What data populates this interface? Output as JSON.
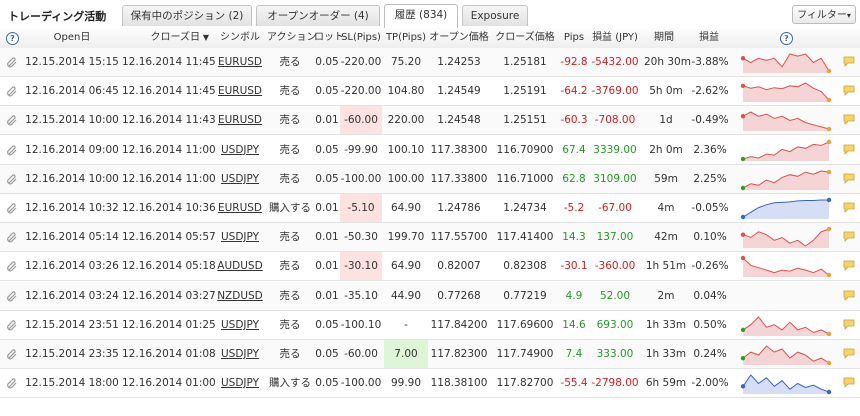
{
  "app": {
    "title": "トレーディング活動",
    "tabs": [
      {
        "label": "保有中のポジション (2)",
        "active": false
      },
      {
        "label": "オープンオーダー (4)",
        "active": false
      },
      {
        "label": "履歴 (834)",
        "active": true
      },
      {
        "label": "Exposure",
        "active": false
      }
    ],
    "filter_label": "フィルター"
  },
  "table": {
    "help_glyph": "?",
    "sort_arrow": "▼",
    "columns": [
      "Open日",
      "クローズ日",
      "シンボル",
      "アクション",
      "ロット",
      "SL(Pips)",
      "TP(Pips)",
      "オープン価格",
      "クローズ価格",
      "Pips",
      "損益 (JPY)",
      "期間",
      "損益"
    ],
    "rows": [
      {
        "open": "12.15.2014 15:15",
        "close": "12.16.2014 11:45",
        "symbol": "EURUSD",
        "action": "売る",
        "lot": "0.05",
        "sl": "-220.00",
        "tp": "75.20",
        "open_price": "1.24253",
        "close_price": "1.25181",
        "pips": "-92.8",
        "pnl": "-5432.00",
        "duration": "20h 30m",
        "pct": "-3.88%",
        "sl_hl": false,
        "tp_hl": false,
        "neg": true,
        "spark": {
          "color": "#d9534f",
          "fill": "#f4d4d4",
          "values": [
            4,
            3,
            4,
            3.5,
            4,
            2,
            5,
            4.5,
            5,
            3,
            4,
            1
          ],
          "start": "#d9534f",
          "end": "#f0a030"
        }
      },
      {
        "open": "12.16.2014 06:45",
        "close": "12.16.2014 11:45",
        "symbol": "EURUSD",
        "action": "売る",
        "lot": "0.05",
        "sl": "-220.00",
        "tp": "104.80",
        "open_price": "1.24549",
        "close_price": "1.25191",
        "pips": "-64.2",
        "pnl": "-3769.00",
        "duration": "5h 0m",
        "pct": "-2.62%",
        "sl_hl": false,
        "tp_hl": false,
        "neg": true,
        "spark": {
          "color": "#d9534f",
          "fill": "#f4d4d4",
          "values": [
            4,
            3.5,
            3.8,
            3.2,
            3.6,
            3.4,
            4,
            3.8,
            4.6,
            3.5,
            2.8,
            1
          ],
          "start": "#d9534f",
          "end": "#f0a030"
        }
      },
      {
        "open": "12.15.2014 10:00",
        "close": "12.16.2014 11:43",
        "symbol": "EURUSD",
        "action": "売る",
        "lot": "0.01",
        "sl": "-60.00",
        "tp": "220.00",
        "open_price": "1.24548",
        "close_price": "1.25151",
        "pips": "-60.3",
        "pnl": "-708.00",
        "duration": "1d",
        "pct": "-0.49%",
        "sl_hl": true,
        "tp_hl": false,
        "neg": true,
        "spark": {
          "color": "#d9534f",
          "fill": "#f4d4d4",
          "values": [
            4,
            5,
            4,
            4.5,
            3.5,
            4,
            3,
            3.5,
            2.5,
            2,
            1.5,
            1
          ],
          "start": "#d9534f",
          "end": "#f0a030"
        }
      },
      {
        "open": "12.16.2014 09:00",
        "close": "12.16.2014 11:00",
        "symbol": "USDJPY",
        "action": "売る",
        "lot": "0.05",
        "sl": "-99.90",
        "tp": "100.10",
        "open_price": "117.38300",
        "close_price": "116.70900",
        "pips": "67.4",
        "pnl": "3339.00",
        "duration": "2h 0m",
        "pct": "2.36%",
        "sl_hl": false,
        "tp_hl": false,
        "neg": false,
        "spark": {
          "color": "#d9534f",
          "fill": "#f4d4d4",
          "values": [
            1,
            1.5,
            1.2,
            2,
            1.8,
            3,
            2.5,
            3.5,
            3.2,
            4,
            3.8,
            4.5
          ],
          "start": "#2aa02a",
          "end": "#f0a030"
        }
      },
      {
        "open": "12.16.2014 10:00",
        "close": "12.16.2014 11:00",
        "symbol": "USDJPY",
        "action": "売る",
        "lot": "0.05",
        "sl": "-100.00",
        "tp": "100.00",
        "open_price": "117.33800",
        "close_price": "116.71000",
        "pips": "62.8",
        "pnl": "3109.00",
        "duration": "59m",
        "pct": "2.25%",
        "sl_hl": false,
        "tp_hl": false,
        "neg": false,
        "spark": {
          "color": "#d9534f",
          "fill": "#f4d4d4",
          "values": [
            1,
            1.8,
            1.5,
            2.5,
            2,
            3,
            3.5,
            3.2,
            4,
            3.6,
            4.2,
            4
          ],
          "start": "#2aa02a",
          "end": "#f0a030"
        }
      },
      {
        "open": "12.16.2014 10:32",
        "close": "12.16.2014 10:36",
        "symbol": "EURUSD",
        "action": "購入する",
        "lot": "0.01",
        "sl": "-5.10",
        "tp": "64.90",
        "open_price": "1.24786",
        "close_price": "1.24734",
        "pips": "-5.2",
        "pnl": "-67.00",
        "duration": "4m",
        "pct": "-0.05%",
        "sl_hl": true,
        "tp_hl": false,
        "neg": true,
        "spark": {
          "color": "#3a62c8",
          "fill": "#d6def6",
          "values": [
            1,
            2,
            3,
            3.6,
            4,
            4.1,
            4.2,
            4.4,
            4.5,
            4.5,
            4.6,
            4.6
          ],
          "start": "#3a62c8",
          "end": "#3a62c8"
        }
      },
      {
        "open": "12.16.2014 05:14",
        "close": "12.16.2014 05:57",
        "symbol": "USDJPY",
        "action": "売る",
        "lot": "0.01",
        "sl": "-50.30",
        "tp": "199.70",
        "open_price": "117.55700",
        "close_price": "117.41400",
        "pips": "14.3",
        "pnl": "137.00",
        "duration": "42m",
        "pct": "0.10%",
        "sl_hl": false,
        "tp_hl": false,
        "neg": false,
        "spark": {
          "color": "#d9534f",
          "fill": "#f4d4d4",
          "values": [
            3,
            2.5,
            3.5,
            3,
            2,
            2.5,
            1.5,
            2,
            1,
            2,
            3.5,
            4
          ],
          "start": "#d9534f",
          "end": "#f0a030"
        }
      },
      {
        "open": "12.16.2014 03:26",
        "close": "12.16.2014 05:18",
        "symbol": "AUDUSD",
        "action": "売る",
        "lot": "0.01",
        "sl": "-30.10",
        "tp": "64.90",
        "open_price": "0.82007",
        "close_price": "0.82308",
        "pips": "-30.1",
        "pnl": "-360.00",
        "duration": "1h 51m",
        "pct": "-0.26%",
        "sl_hl": true,
        "tp_hl": false,
        "neg": true,
        "spark": {
          "color": "#d9534f",
          "fill": "#f4d4d4",
          "values": [
            4.5,
            3,
            2.5,
            2,
            1.5,
            2,
            1.8,
            2.4,
            2,
            1.5,
            2.2,
            1
          ],
          "start": "#d9534f",
          "end": "#f0a030"
        }
      },
      {
        "open": "12.16.2014 03:24",
        "close": "12.16.2014 03:27",
        "symbol": "NZDUSD",
        "action": "売る",
        "lot": "0.01",
        "sl": "-35.10",
        "tp": "44.90",
        "open_price": "0.77268",
        "close_price": "0.77219",
        "pips": "4.9",
        "pnl": "52.00",
        "duration": "2m",
        "pct": "0.04%",
        "sl_hl": false,
        "tp_hl": false,
        "neg": false,
        "spark": null
      },
      {
        "open": "12.15.2014 23:51",
        "close": "12.16.2014 01:25",
        "symbol": "USDJPY",
        "action": "売る",
        "lot": "0.05",
        "sl": "-100.10",
        "tp": "-",
        "open_price": "117.84200",
        "close_price": "117.69600",
        "pips": "14.6",
        "pnl": "693.00",
        "duration": "1h 33m",
        "pct": "0.50%",
        "sl_hl": false,
        "tp_hl": false,
        "neg": false,
        "spark": {
          "color": "#d9534f",
          "fill": "#f4d4d4",
          "values": [
            2,
            3,
            4.5,
            2.5,
            3,
            2,
            3.5,
            2,
            2.5,
            1.5,
            2,
            1.2
          ],
          "start": "#2aa02a",
          "end": "#f0a030"
        }
      },
      {
        "open": "12.15.2014 23:35",
        "close": "12.16.2014 01:08",
        "symbol": "USDJPY",
        "action": "売る",
        "lot": "0.05",
        "sl": "-60.00",
        "tp": "7.00",
        "open_price": "117.82300",
        "close_price": "117.74900",
        "pips": "7.4",
        "pnl": "333.00",
        "duration": "1h 33m",
        "pct": "0.24%",
        "sl_hl": false,
        "tp_hl": true,
        "neg": false,
        "spark": {
          "color": "#d9534f",
          "fill": "#f4d4d4",
          "values": [
            2,
            3,
            2.5,
            4,
            3,
            3.5,
            2,
            3,
            2.5,
            1.5,
            2,
            1.2
          ],
          "start": "#2aa02a",
          "end": "#f0a030"
        }
      },
      {
        "open": "12.15.2014 18:00",
        "close": "12.16.2014 01:00",
        "symbol": "USDJPY",
        "action": "購入する",
        "lot": "0.05",
        "sl": "-100.00",
        "tp": "99.90",
        "open_price": "118.38100",
        "close_price": "117.82700",
        "pips": "-55.4",
        "pnl": "-2798.00",
        "duration": "6h 59m",
        "pct": "-2.00%",
        "sl_hl": false,
        "tp_hl": false,
        "neg": true,
        "spark": {
          "color": "#3a62c8",
          "fill": "#d6def6",
          "values": [
            2,
            4,
            2.5,
            3.5,
            2,
            3,
            1.5,
            2.5,
            1.8,
            2.2,
            1.5,
            1
          ],
          "start": "#3a62c8",
          "end": "#3a62c8"
        }
      }
    ]
  }
}
